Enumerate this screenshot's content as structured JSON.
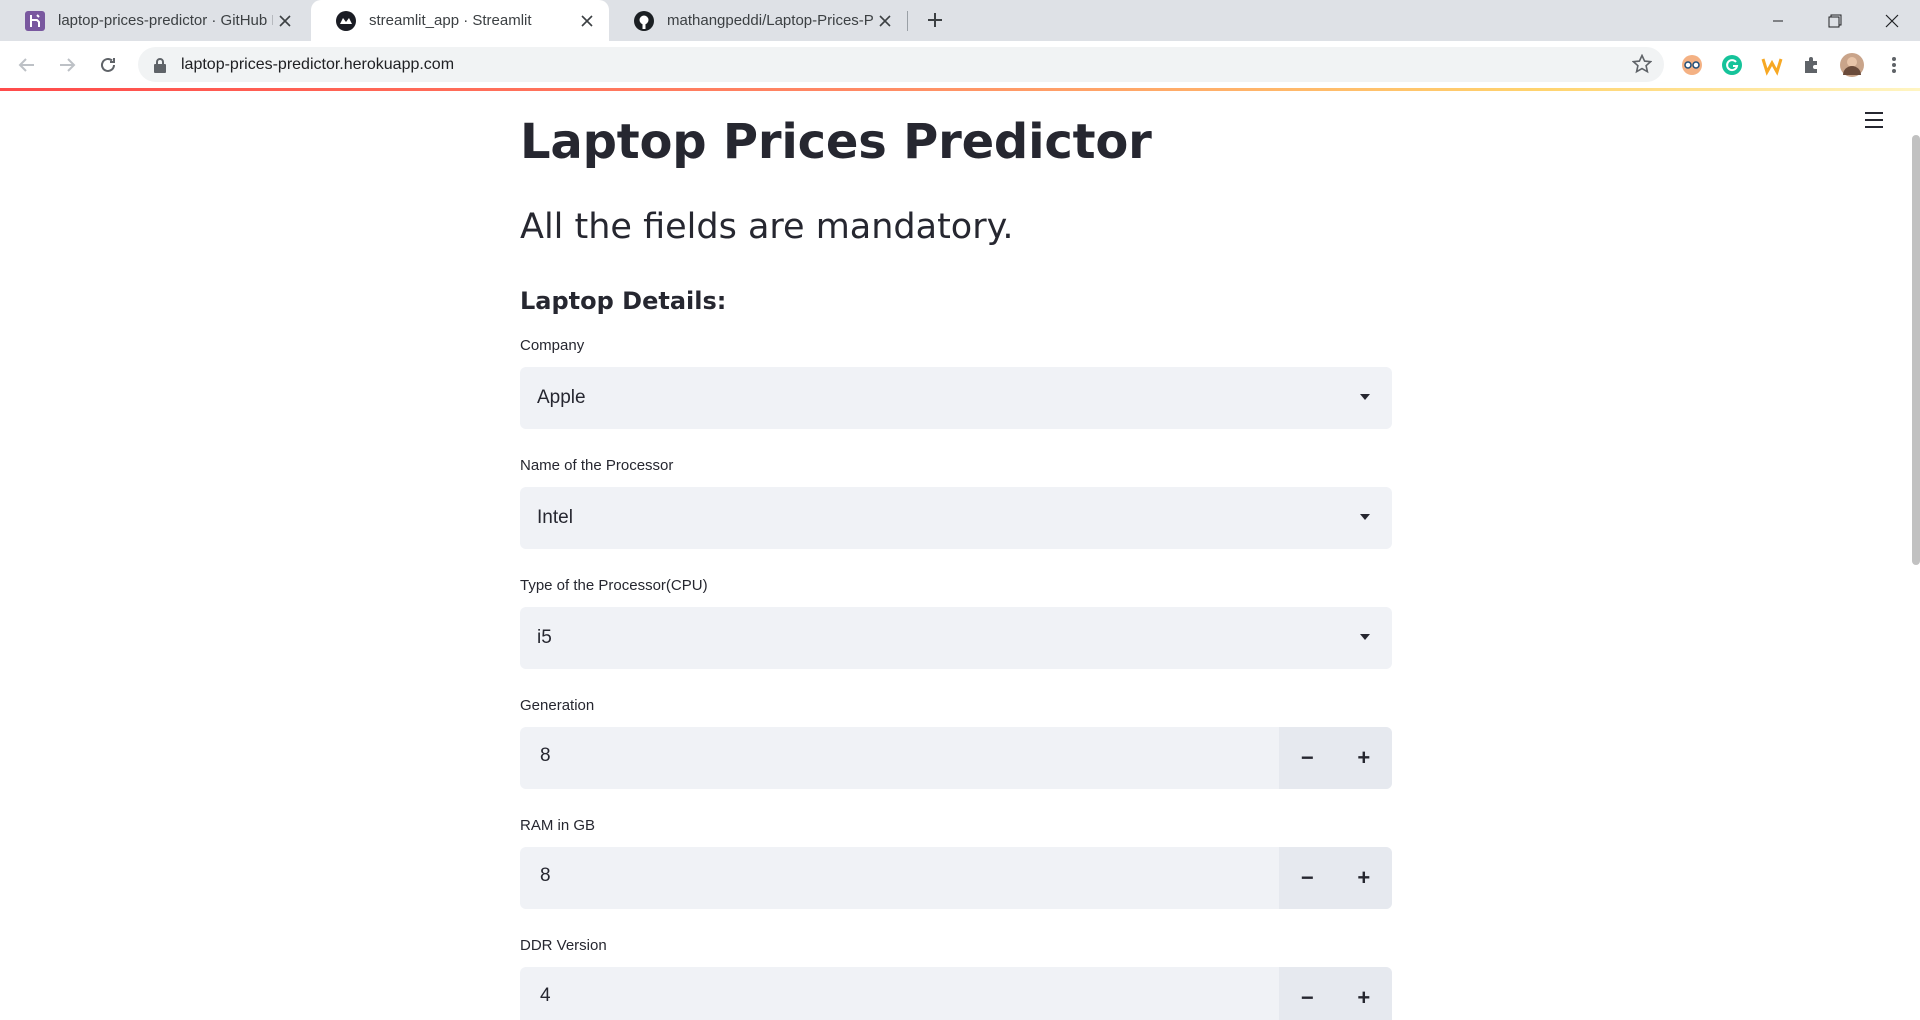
{
  "browser": {
    "tabs": [
      {
        "title": "laptop-prices-predictor · GitHub I",
        "favicon": "heroku-icon",
        "active": false
      },
      {
        "title": "streamlit_app · Streamlit",
        "favicon": "streamlit-icon",
        "active": true
      },
      {
        "title": "mathangpeddi/Laptop-Prices-Pre",
        "favicon": "github-icon",
        "active": false
      }
    ],
    "url": "laptop-prices-predictor.herokuapp.com"
  },
  "app": {
    "title": "Laptop Prices Predictor",
    "subtitle": "All the fields are mandatory.",
    "section": "Laptop Details:",
    "fields": {
      "company": {
        "label": "Company",
        "value": "Apple"
      },
      "processor_name": {
        "label": "Name of the Processor",
        "value": "Intel"
      },
      "processor_type": {
        "label": "Type of the Processor(CPU)",
        "value": "i5"
      },
      "generation": {
        "label": "Generation",
        "value": "8"
      },
      "ram": {
        "label": "RAM in GB",
        "value": "8"
      },
      "ddr": {
        "label": "DDR Version",
        "value": "4"
      }
    },
    "stepper": {
      "minus": "−",
      "plus": "+"
    }
  },
  "colors": {
    "accent": "#ff4b4b",
    "input_bg": "#f0f2f6",
    "text": "#262730"
  }
}
